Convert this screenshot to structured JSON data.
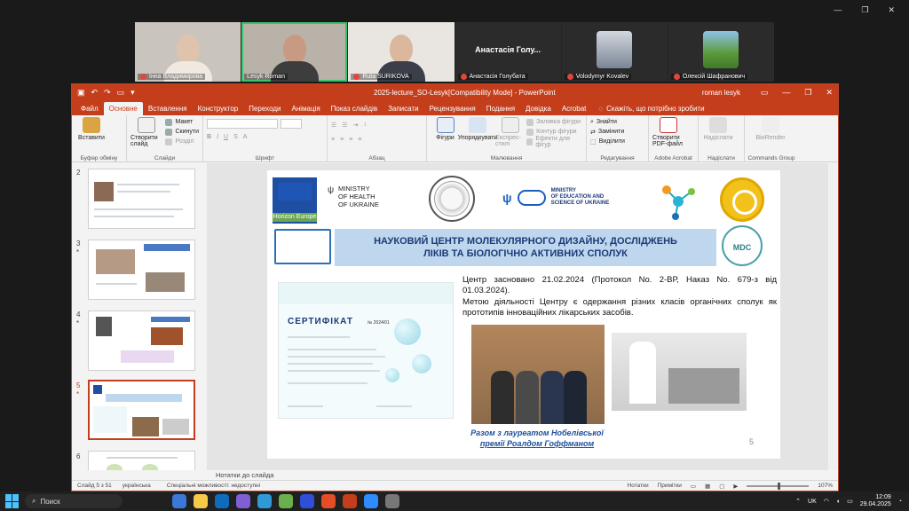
{
  "zoom": {
    "participants": [
      {
        "name": "Інна Владимирова"
      },
      {
        "name": "Lesyk Roman"
      },
      {
        "name": "Ruta SURIKOVA"
      },
      {
        "name": "Анастасія Голубата",
        "display": "Анастасія Голу..."
      },
      {
        "name": "Volodymyr Kovalev"
      },
      {
        "name": "Олексій Шафранович"
      }
    ]
  },
  "ppt": {
    "doc_title": "2025-lecture_SO-Lesyk[Compatibility Mode] - PowerPoint",
    "user": "roman lesyk",
    "tabs": [
      "Файл",
      "Основне",
      "Вставлення",
      "Конструктор",
      "Переходи",
      "Анімація",
      "Показ слайдів",
      "Записати",
      "Рецензування",
      "Подання",
      "Довідка",
      "Acrobat"
    ],
    "tell_me": "Скажіть, що потрібно зробити",
    "ribbon": {
      "paste": "Вставити",
      "clipboard_group": "Буфер обміну",
      "new_slide": "Створити слайд",
      "layout": "Макет",
      "reset": "Скинути",
      "section": "Розділ",
      "slides_group": "Слайди",
      "font_group": "Шрифт",
      "paragraph_group": "Абзац",
      "shapes": "Фігури",
      "arrange": "Упорядкувати",
      "quick_styles": "Експрес-стилі",
      "shape_fill": "Заливка фігури",
      "shape_outline": "Контур фігури",
      "shape_effects": "Ефекти для фігур",
      "drawing_group": "Малювання",
      "find": "Знайти",
      "replace": "Замінити",
      "select": "Виділити",
      "editing_group": "Редагування",
      "create_pdf": "Створити PDF-файл",
      "acrobat_group": "Adobe Acrobat",
      "send": "Надіслати",
      "send_group": "Надіслати",
      "biorender": "BioRender",
      "commands_group": "Commands Group"
    },
    "thumbnails": [
      {
        "num": "2",
        "star": ""
      },
      {
        "num": "3",
        "star": "*"
      },
      {
        "num": "4",
        "star": "*"
      },
      {
        "num": "5",
        "star": "*"
      },
      {
        "num": "6",
        "star": ""
      }
    ],
    "slide": {
      "horizon_label": "Horizon Europe",
      "ministry_health": [
        "MINISTRY",
        "OF HEALTH",
        "OF UKRAINE"
      ],
      "ministry_edu": [
        "MINISTRY",
        "OF EDUCATION AND",
        "SCIENCE OF UKRAINE"
      ],
      "mdc_label": "MDC",
      "title_line1": "НАУКОВИЙ ЦЕНТР МОЛЕКУЛЯРНОГО ДИЗАЙНУ, ДОСЛІДЖЕНЬ",
      "title_line2": "ЛІКІВ ТА БІОЛОГІЧНО АКТИВНИХ СПОЛУК",
      "cert_title": "СЕРТИФІКАТ",
      "cert_number": "№ 2024/01",
      "paragraph1": "Центр засновано 21.02.2024 (Протокол No. 2-ВР, Наказ No. 679-з від 01.03.2024).",
      "paragraph2": "Метою діяльності Центру є одержання різних класів органічних сполук як прототипів інноваційних лікарських засобів.",
      "caption_line1": "Разом з лауреатом Нобелівської",
      "caption_line2": "премії Роалдом Гоффманом",
      "page_number": "5"
    },
    "notes_placeholder": "Нотатки до слайда",
    "status": {
      "slide_of": "Слайд 5 з 51",
      "language": "українська",
      "accessibility": "Спеціальні можливості: недоступні",
      "notes": "Нотатки",
      "comments": "Примітки",
      "zoom": "107%"
    }
  },
  "taskbar": {
    "search": "Поиск",
    "lang": "UK",
    "time": "12:09",
    "date": "29.04.2025"
  }
}
